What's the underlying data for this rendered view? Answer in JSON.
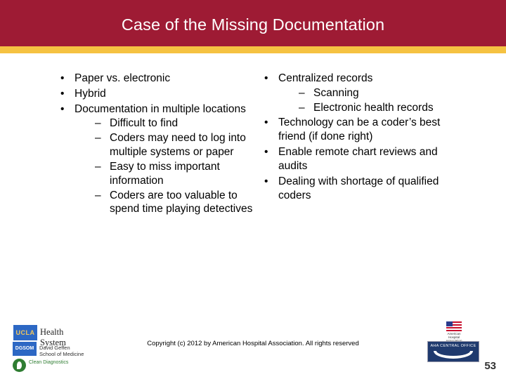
{
  "slide": {
    "title": "Case of the Missing Documentation",
    "number": "53",
    "footer": "Copyright (c) 2012 by  American Hospital Association. All rights reserved",
    "colors": {
      "header_bar": "#9e1b34",
      "accent_bar": "#f5c242",
      "text": "#000000",
      "background": "#ffffff"
    }
  },
  "columns": {
    "left": [
      {
        "text": "Paper vs. electronic",
        "sub": []
      },
      {
        "text": "Hybrid",
        "sub": []
      },
      {
        "text": "Documentation in multiple locations",
        "sub": [
          "Difficult to find",
          "Coders may need to log into multiple systems or paper",
          "Easy to miss important information",
          "Coders are too valuable to spend time playing detectives"
        ]
      }
    ],
    "right": [
      {
        "text": "Centralized records",
        "sub": [
          "Scanning",
          "Electronic health records"
        ]
      },
      {
        "text": "Technology can be a coder’s best friend (if done right)",
        "sub": []
      },
      {
        "text": "Enable remote chart reviews and audits",
        "sub": []
      },
      {
        "text": "Dealing with shortage of qualified coders",
        "sub": []
      }
    ]
  },
  "bullets": {
    "level1": "•",
    "level2": "–"
  },
  "logos": {
    "ucla_mark": "UCLA",
    "ucla_text": "Health System",
    "geffen_mark": "DGSOM",
    "geffen_text": "David Geffen School of Medicine",
    "health_text": "Clean\nDiagnostics",
    "aha_top": "AHA CENTRAL OFFICE",
    "american_text": "American Hospital Association"
  }
}
